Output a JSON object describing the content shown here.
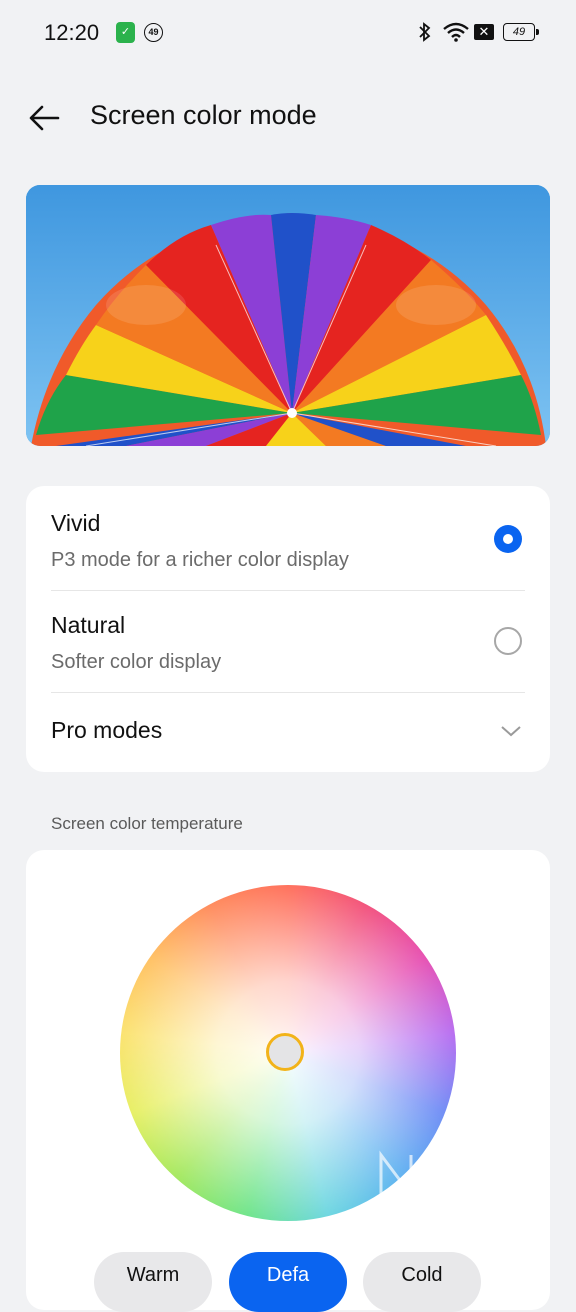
{
  "status_bar": {
    "time": "12:20",
    "notification_badge": "49",
    "battery": "49",
    "icons": [
      "app-notification-icon",
      "bluetooth-icon",
      "wifi-icon",
      "no-sim-icon",
      "battery-icon"
    ]
  },
  "header": {
    "title": "Screen color mode",
    "back_icon": "back-arrow-icon"
  },
  "color_modes": {
    "options": [
      {
        "label": "Vivid",
        "description": "P3 mode for a richer color display",
        "selected": true
      },
      {
        "label": "Natural",
        "description": "Softer color display",
        "selected": false
      }
    ],
    "pro_modes_label": "Pro modes"
  },
  "temperature": {
    "section_label": "Screen color temperature",
    "presets": [
      "Warm",
      "Defa",
      "Cold"
    ],
    "selected_preset": "Defa"
  },
  "watermark": "NYPGKS",
  "colors": {
    "accent": "#0a64f0",
    "background": "#f1f2f4",
    "card": "#ffffff",
    "knob_ring": "#f2b319"
  }
}
